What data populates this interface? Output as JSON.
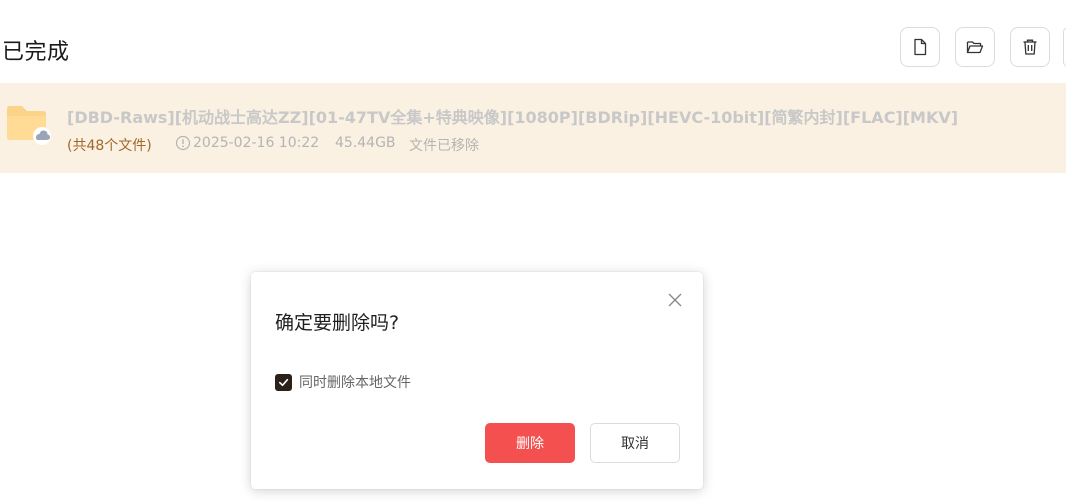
{
  "header": {
    "title": "已完成",
    "toolbar": {
      "new_file_icon": "file-icon",
      "open_folder_icon": "folder-open-icon",
      "delete_icon": "trash-icon"
    }
  },
  "task": {
    "name": "[DBD-Raws][机动战士高达ZZ][01-47TV全集+特典映像][1080P][BDRip][HEVC-10bit][简繁内封][FLAC][MKV]",
    "file_count": "(共48个文件)",
    "time": "2025-02-16 10:22",
    "size": "45.44GB",
    "status": "文件已移除"
  },
  "dialog": {
    "title": "确定要删除吗?",
    "checkbox_label": "同时删除本地文件",
    "checkbox_checked": true,
    "delete_label": "删除",
    "cancel_label": "取消"
  },
  "colors": {
    "row_background": "#faf1e3",
    "delete_button": "#f55050",
    "file_count_text": "#a0692a"
  }
}
